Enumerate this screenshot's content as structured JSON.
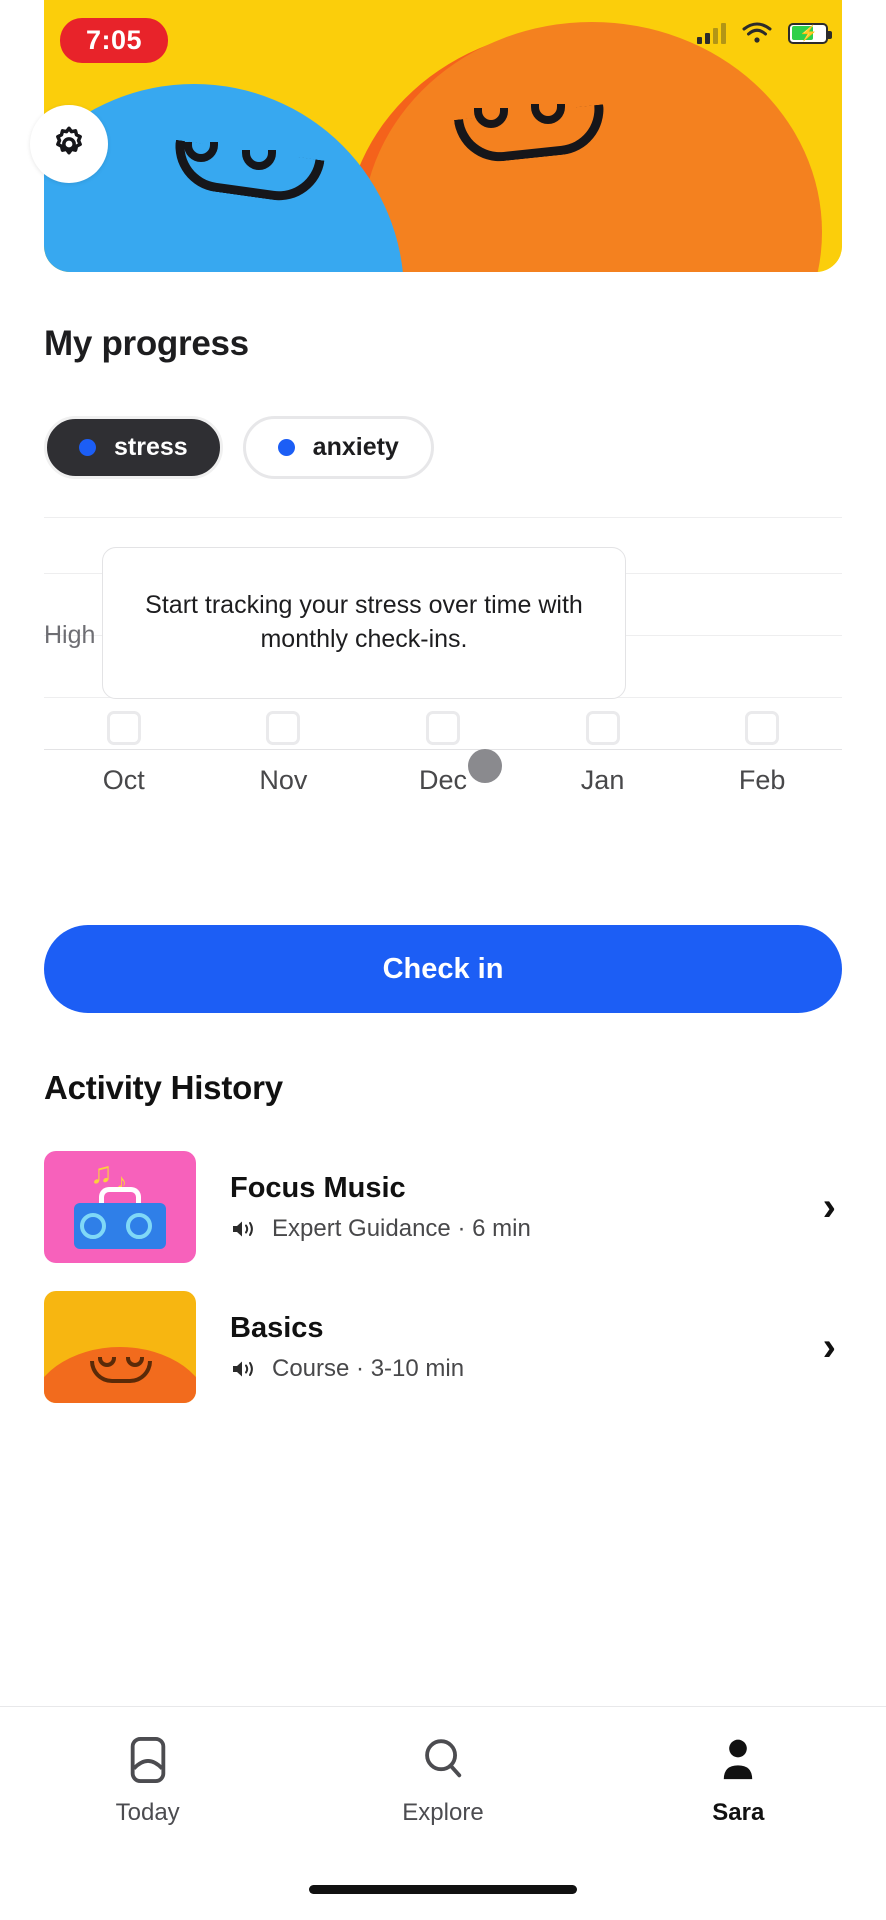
{
  "statusbar": {
    "time": "7:05",
    "signal_icon": "signal-bars-icon",
    "wifi_icon": "wifi-icon",
    "battery_icon": "battery-charging-icon"
  },
  "hero": {
    "settings_icon": "gear-icon",
    "face_left": "blue-smiley-face",
    "face_right": "orange-smiley-face"
  },
  "progress": {
    "title": "My progress",
    "chips": [
      {
        "label": "stress",
        "selected": true,
        "dot_color": "#1C5EF5"
      },
      {
        "label": "anxiety",
        "selected": false,
        "dot_color": "#1C5EF5"
      }
    ],
    "empty_state": "Start tracking your stress over time with monthly check-ins.",
    "cta_label": "Check in"
  },
  "chart_data": {
    "type": "bar",
    "title": "My progress",
    "series_name": "stress",
    "categories": [
      "Oct",
      "Nov",
      "Dec",
      "Jan",
      "Feb"
    ],
    "values": [
      null,
      null,
      null,
      null,
      null
    ],
    "ytick_labels": [
      "High"
    ],
    "ylabel": "",
    "xlabel": "",
    "grid": true,
    "legend": [
      "stress",
      "anxiety"
    ],
    "annotation": "Start tracking your stress over time with monthly check-ins.",
    "note": "no data recorded; empty placeholder slots shown for each month"
  },
  "activity": {
    "title": "Activity History",
    "items": [
      {
        "title": "Focus Music",
        "meta": "Expert Guidance · 6 min",
        "audio_icon": "speaker-icon",
        "chevron": "›",
        "thumb": "music-boombox-thumbnail",
        "thumb_color": "#F761BB"
      },
      {
        "title": "Basics",
        "meta": "Course · 3-10 min",
        "audio_icon": "speaker-icon",
        "chevron": "›",
        "thumb": "smiley-face-thumbnail",
        "thumb_color": "#F7B611"
      }
    ]
  },
  "tabbar": {
    "tabs": [
      {
        "label": "Today",
        "icon": "bookmark-icon",
        "active": false
      },
      {
        "label": "Explore",
        "icon": "search-icon",
        "active": false
      },
      {
        "label": "Sara",
        "icon": "person-icon",
        "active": true
      }
    ]
  }
}
